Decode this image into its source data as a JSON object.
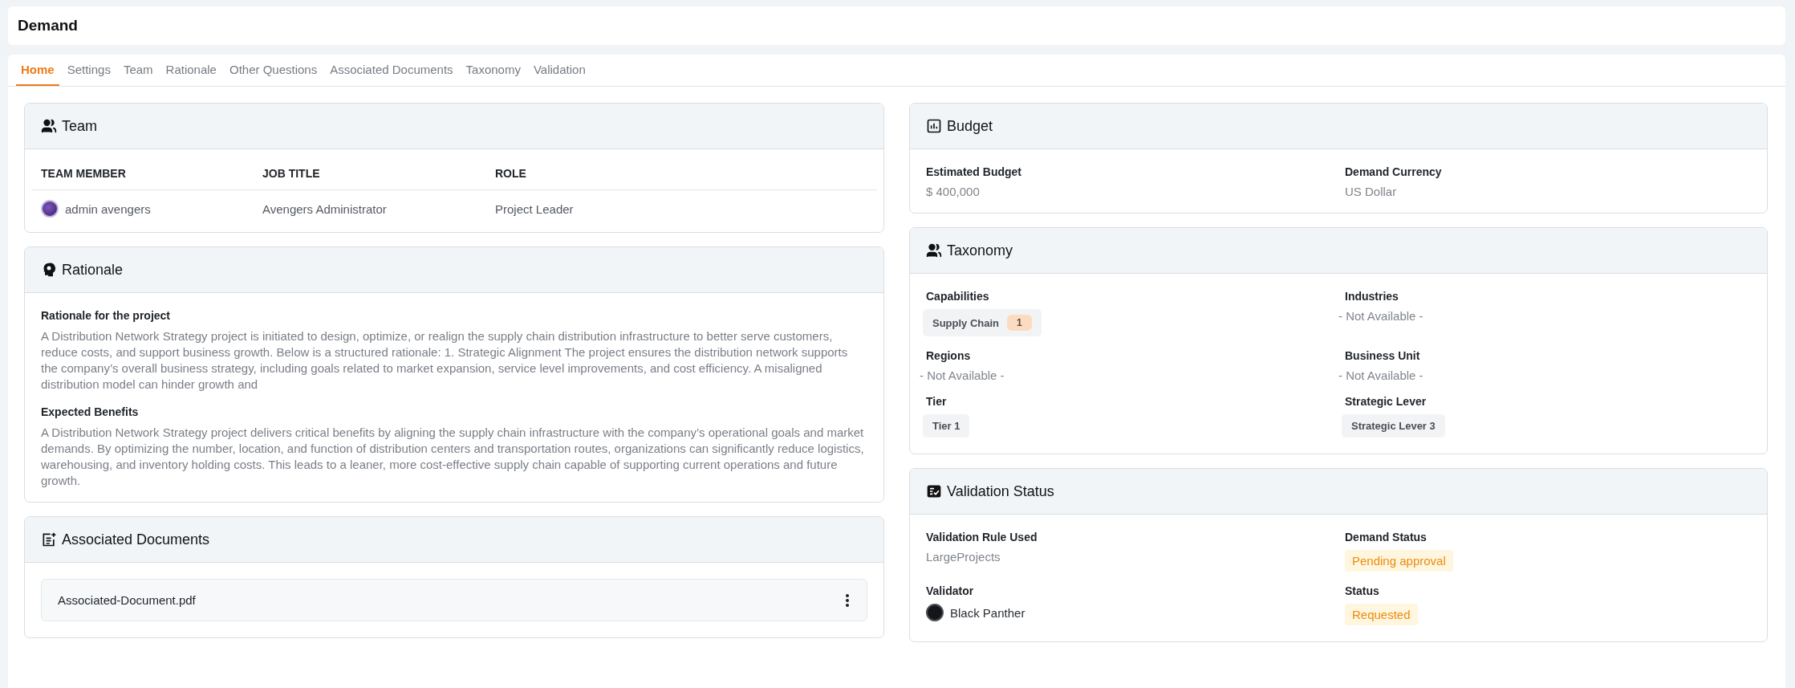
{
  "page": {
    "title": "Demand"
  },
  "tabs": [
    {
      "label": "Home",
      "selected": true
    },
    {
      "label": "Settings",
      "selected": false
    },
    {
      "label": "Team",
      "selected": false
    },
    {
      "label": "Rationale",
      "selected": false
    },
    {
      "label": "Other Questions",
      "selected": false
    },
    {
      "label": "Associated Documents",
      "selected": false
    },
    {
      "label": "Taxonomy",
      "selected": false
    },
    {
      "label": "Validation",
      "selected": false
    }
  ],
  "team": {
    "title": "Team",
    "columns": [
      "TEAM MEMBER",
      "JOB TITLE",
      "ROLE"
    ],
    "rows": [
      {
        "member": "admin avengers",
        "job_title": "Avengers Administrator",
        "role": "Project Leader"
      }
    ]
  },
  "rationale": {
    "title": "Rationale",
    "sections": [
      {
        "heading": "Rationale for the project",
        "text": "A Distribution Network Strategy project is initiated to design, optimize, or realign the supply chain distribution infrastructure to better serve customers, reduce costs, and support business growth. Below is a structured rationale: 1. Strategic Alignment The project ensures the distribution network supports the company’s overall business strategy, including goals related to market expansion, service level improvements, and cost efficiency. A misaligned distribution model can hinder growth and"
      },
      {
        "heading": "Expected Benefits",
        "text": "A Distribution Network Strategy project delivers critical benefits by aligning the supply chain infrastructure with the company’s operational goals and market demands. By optimizing the number, location, and function of distribution centers and transportation routes, organizations can significantly reduce logistics, warehousing, and inventory holding costs. This leads to a leaner, more cost-effective supply chain capable of supporting current operations and future growth."
      }
    ]
  },
  "documents": {
    "title": "Associated Documents",
    "files": [
      "Associated-Document.pdf"
    ]
  },
  "budget": {
    "title": "Budget",
    "fields": [
      {
        "label": "Estimated Budget",
        "kind": "text",
        "value": "$ 400,000"
      },
      {
        "label": "Demand Currency",
        "kind": "text",
        "value": "US Dollar"
      }
    ]
  },
  "taxonomy": {
    "title": "Taxonomy",
    "fields": [
      {
        "label": "Capabilities",
        "kind": "chips",
        "chips": [
          {
            "label": "Supply Chain",
            "count": "1"
          }
        ]
      },
      {
        "label": "Industries",
        "kind": "none",
        "value": "- Not Available -"
      },
      {
        "label": "Regions",
        "kind": "none",
        "value": "- Not Available -"
      },
      {
        "label": "Business Unit",
        "kind": "none",
        "value": "- Not Available -"
      },
      {
        "label": "Tier",
        "kind": "chips",
        "chips": [
          {
            "label": "Tier 1"
          }
        ]
      },
      {
        "label": "Strategic Lever",
        "kind": "chips",
        "chips": [
          {
            "label": "Strategic Lever 3"
          }
        ]
      }
    ]
  },
  "validation": {
    "title": "Validation Status",
    "fields": [
      {
        "label": "Validation Rule Used",
        "kind": "text",
        "value": "LargeProjects"
      },
      {
        "label": "Demand Status",
        "kind": "status",
        "value": "Pending approval"
      },
      {
        "label": "Validator",
        "kind": "user",
        "value": "Black Panther"
      },
      {
        "label": "Status",
        "kind": "status",
        "value": "Requested"
      }
    ]
  }
}
